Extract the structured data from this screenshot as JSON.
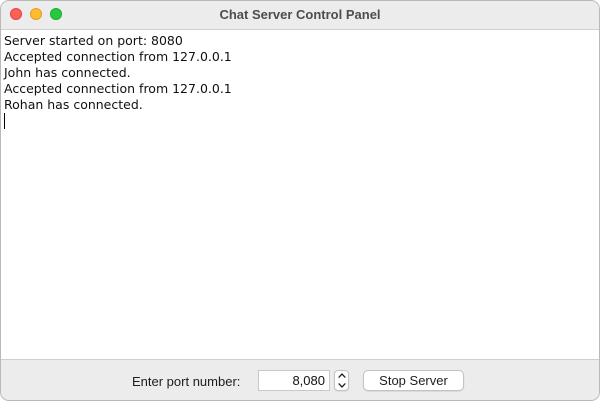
{
  "window": {
    "title": "Chat Server Control Panel"
  },
  "log": {
    "lines": [
      "Server started on port: 8080",
      "Accepted connection from 127.0.0.1",
      "John has connected.",
      "Accepted connection from 127.0.0.1",
      "Rohan has connected."
    ]
  },
  "controls": {
    "port_label": "Enter port number:",
    "port_value": "8,080",
    "stop_button_label": "Stop Server"
  },
  "colors": {
    "close": "#fe5f57",
    "minimize": "#febc2e",
    "maximize": "#28c840"
  },
  "icons": {
    "stepper_up": "chevron-up-icon",
    "stepper_down": "chevron-down-icon"
  }
}
